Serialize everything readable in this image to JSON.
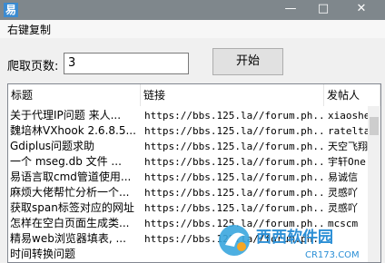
{
  "window": {
    "icon": "app-icon",
    "minimize": "—",
    "maximize": "□",
    "close": "✕"
  },
  "menu": {
    "item1": "右键复制"
  },
  "form": {
    "pages_label": "爬取页数:",
    "pages_value": "3",
    "start_label": "开始"
  },
  "table": {
    "headers": [
      "标题",
      "链接",
      "发帖人"
    ],
    "rows": [
      [
        "关于代理IP问题 来人...",
        "https://bbs.125.la//forum.ph...",
        "xiaoshe"
      ],
      [
        "魏培林VXhook 2.6.8.5...",
        "https://bbs.125.la//forum.ph...",
        "ratelta"
      ],
      [
        "Gdiplus问题求助",
        "https://bbs.125.la//forum.ph...",
        "天空飞翔"
      ],
      [
        "一个 mseg.db 文件 ...",
        "https://bbs.125.la//forum.ph...",
        "宇轩One"
      ],
      [
        "易语言取cmd管道使用...",
        "https://bbs.125.la//forum.ph...",
        "易诚信"
      ],
      [
        "麻烦大佬帮忙分析一个...",
        "https://bbs.125.la//forum.ph...",
        "灵感吖"
      ],
      [
        "获取span标签对应的网址",
        "https://bbs.125.la//forum.ph...",
        "灵感吖"
      ],
      [
        "怎样在空白页面生成类...",
        "https://bbs.125.la//forum.ph...",
        "mcscm"
      ],
      [
        "精易web浏览器填表, ...",
        "https://bbs.125.la//forum.ph...",
        ""
      ],
      [
        "时间转换问题",
        "",
        ""
      ]
    ]
  },
  "watermark": {
    "text": "西西软件园",
    "url": "CR173.COM"
  }
}
